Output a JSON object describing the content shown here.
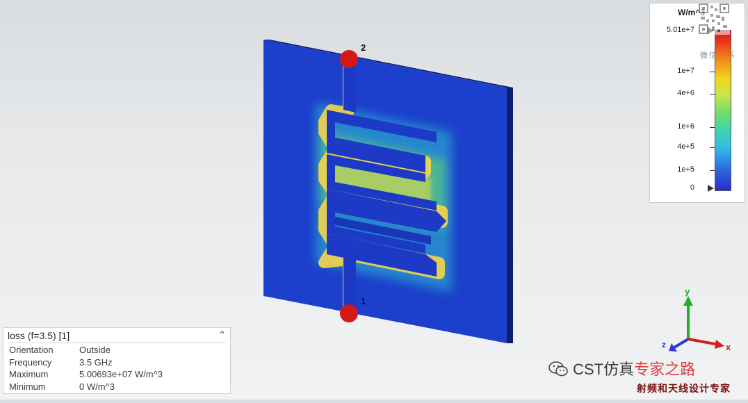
{
  "legend": {
    "unit": "W/m^3",
    "ticks": [
      "5.01e+7",
      "1e+7",
      "4e+6",
      "1e+6",
      "4e+5",
      "1e+5",
      "0"
    ],
    "watermark": "微信联系"
  },
  "viewport": {
    "port_labels": [
      "2",
      "1"
    ]
  },
  "info_panel": {
    "title": "loss (f=3.5) [1]",
    "rows": [
      {
        "key": "Orientation",
        "value": "Outside"
      },
      {
        "key": "Frequency",
        "value": "3.5 GHz"
      },
      {
        "key": "Maximum",
        "value": "5.00693e+07 W/m^3"
      },
      {
        "key": "Minimum",
        "value": "0 W/m^3"
      }
    ]
  },
  "axes": {
    "x": "x",
    "y": "y",
    "z": "z"
  },
  "watermark": {
    "brand": "CST仿真",
    "brand_red": "专家之路",
    "subtitle": "射频和天线设计专家"
  },
  "colors": {
    "substrate": "#1a3ec8",
    "substrate_side": "#0e1f6e",
    "trace": "#1e3cc8",
    "port": "#d01818",
    "axis_x": "#d42020",
    "axis_y": "#22b022",
    "axis_z": "#2a3ad8"
  }
}
